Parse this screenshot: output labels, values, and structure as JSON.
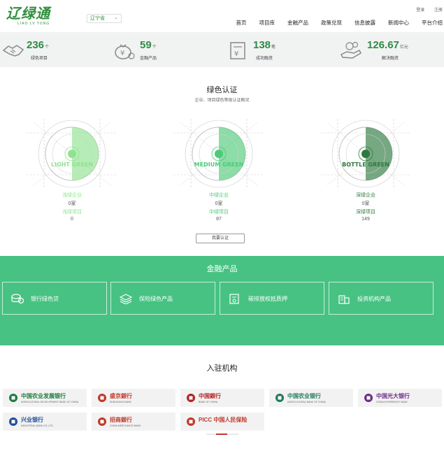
{
  "header": {
    "logo_text": "辽绿通",
    "logo_sub": "LIAO LV TONG",
    "region": "辽宁省",
    "top_links": [
      "登录",
      "注册"
    ],
    "nav": [
      "首页",
      "项目库",
      "金融产品",
      "政策兑现",
      "信息披露",
      "新闻中心",
      "平台介绍"
    ]
  },
  "stats": [
    {
      "value": "236",
      "unit": "个",
      "label": "绿色项目",
      "icon": "handshake-icon"
    },
    {
      "value": "59",
      "unit": "个",
      "label": "金融产品",
      "icon": "money-bag-icon"
    },
    {
      "value": "138",
      "unit": "笔",
      "label": "成功融资",
      "icon": "document-yen-icon"
    },
    {
      "value": "126.67",
      "unit": "亿元",
      "label": "解决融资",
      "icon": "hand-coins-icon"
    }
  ],
  "certification": {
    "title": "绿色认证",
    "subtitle": "企业、项目绿色等级认证概况",
    "levels": [
      {
        "badge": "LIGHT GREEN",
        "name_company": "浅绿企业",
        "company_count": "0家",
        "name_project": "浅绿项目",
        "project_count": "0",
        "color": "#8fe38f"
      },
      {
        "badge": "MEDIUM GREEN",
        "name_company": "中绿企业",
        "company_count": "0家",
        "name_project": "中绿项目",
        "project_count": "87",
        "color": "#4ecb7a"
      },
      {
        "badge": "BOTTLE GREEN",
        "name_company": "深绿企业",
        "company_count": "0家",
        "name_project": "深绿项目",
        "project_count": "149",
        "color": "#2d7a3f"
      }
    ],
    "button": "我要认证"
  },
  "finance": {
    "title": "金融产品",
    "cards": [
      {
        "label": "银行绿色贷",
        "icon": "coins-icon"
      },
      {
        "label": "保险绿色产品",
        "icon": "layers-icon"
      },
      {
        "label": "碳排放权抵质押",
        "icon": "certificate-icon"
      },
      {
        "label": "投资机构产品",
        "icon": "building-icon"
      }
    ]
  },
  "institutions": {
    "title": "入驻机构",
    "items": [
      {
        "cn": "中国农业发展银行",
        "en": "AGRICULTURAL DEVELOPMENT BANK OF CHINA",
        "color": "#1e7a3b"
      },
      {
        "cn": "盛京銀行",
        "en": "SHENGJING BANK",
        "color": "#c0392b"
      },
      {
        "cn": "中国銀行",
        "en": "BANK OF CHINA",
        "color": "#b22222"
      },
      {
        "cn": "中国农业银行",
        "en": "AGRICULTURAL BANK OF CHINA",
        "color": "#1e7a5a"
      },
      {
        "cn": "中国光大银行",
        "en": "CHINA EVERBRIGHT BANK",
        "color": "#6b2d86"
      },
      {
        "cn": "兴业银行",
        "en": "INDUSTRIAL BANK CO.,LTD.",
        "color": "#1f4e9a"
      },
      {
        "cn": "招商銀行",
        "en": "CHINA MERCHANTS BANK",
        "color": "#c0392b"
      },
      {
        "cn": "PICC 中国人民保险",
        "en": "",
        "color": "#c0392b"
      }
    ]
  }
}
